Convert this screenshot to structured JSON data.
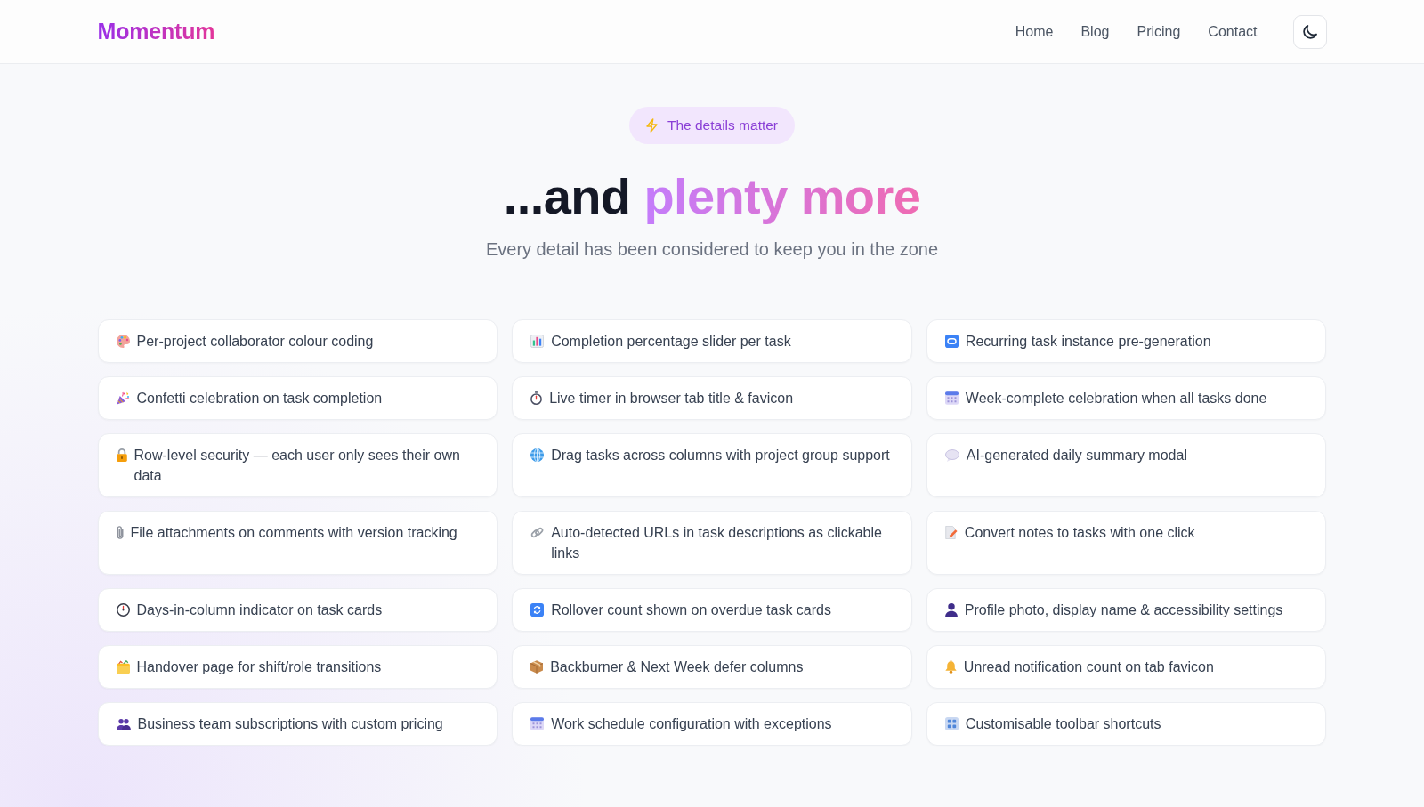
{
  "header": {
    "logo": "Momentum",
    "nav": [
      {
        "label": "Home"
      },
      {
        "label": "Blog"
      },
      {
        "label": "Pricing"
      },
      {
        "label": "Contact"
      }
    ]
  },
  "hero": {
    "badge": "The details matter",
    "title_start": "...and",
    "title_highlight": "plenty more",
    "subtitle": "Every detail has been considered to keep you in the zone"
  },
  "features": [
    {
      "kind": "palette",
      "text": "Per-project collaborator colour coding"
    },
    {
      "kind": "chart",
      "text": "Completion percentage slider per task"
    },
    {
      "kind": "repeat",
      "text": "Recurring task instance pre-generation"
    },
    {
      "kind": "confetti",
      "text": "Confetti celebration on task completion"
    },
    {
      "kind": "stopwatch",
      "text": "Live timer in browser tab title & favicon"
    },
    {
      "kind": "calendar",
      "text": "Week-complete celebration when all tasks done"
    },
    {
      "kind": "lock",
      "text": "Row-level security — each user only sees their own data"
    },
    {
      "kind": "globe",
      "text": "Drag tasks across columns with project group support"
    },
    {
      "kind": "speech",
      "text": "AI-generated daily summary modal"
    },
    {
      "kind": "paperclip",
      "text": "File attachments on comments with version tracking"
    },
    {
      "kind": "link",
      "text": "Auto-detected URLs in task descriptions as clickable links"
    },
    {
      "kind": "memo",
      "text": "Convert notes to tasks with one click"
    },
    {
      "kind": "clock",
      "text": "Days-in-column indicator on task cards"
    },
    {
      "kind": "refresh",
      "text": "Rollover count shown on overdue task cards"
    },
    {
      "kind": "person",
      "text": "Profile photo, display name & accessibility settings"
    },
    {
      "kind": "folder",
      "text": "Handover page for shift/role transitions"
    },
    {
      "kind": "package",
      "text": "Backburner & Next Week defer columns"
    },
    {
      "kind": "bell",
      "text": "Unread notification count on tab favicon"
    },
    {
      "kind": "people",
      "text": "Business team subscriptions with custom pricing"
    },
    {
      "kind": "calendar",
      "text": "Work schedule configuration with exceptions"
    },
    {
      "kind": "grid",
      "text": "Customisable toolbar shortcuts"
    }
  ]
}
